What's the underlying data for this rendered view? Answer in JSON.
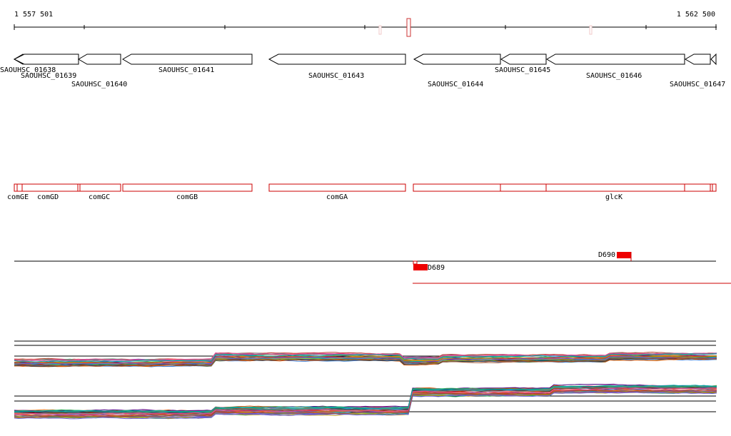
{
  "axis": {
    "start_label": "1 557 501",
    "end_label": "1 562 500"
  },
  "loci": [
    {
      "label": "SAOUHSC_01638"
    },
    {
      "label": "SAOUHSC_01639"
    },
    {
      "label": "SAOUHSC_01640"
    },
    {
      "label": "SAOUHSC_01641"
    },
    {
      "label": "SAOUHSC_01643"
    },
    {
      "label": "SAOUHSC_01644"
    },
    {
      "label": "SAOUHSC_01645"
    },
    {
      "label": "SAOUHSC_01646"
    },
    {
      "label": "SAOUHSC_01647"
    }
  ],
  "genes": [
    {
      "label": "comGE"
    },
    {
      "label": "comGD"
    },
    {
      "label": "comGC"
    },
    {
      "label": "comGB"
    },
    {
      "label": "comGA"
    },
    {
      "label": "glcK"
    }
  ],
  "features": [
    {
      "label": "D689"
    },
    {
      "label": "D690"
    }
  ],
  "colors": {
    "gene_outline": "#cc0000",
    "feature_fill": "#ee0000",
    "axis": "#000000"
  }
}
